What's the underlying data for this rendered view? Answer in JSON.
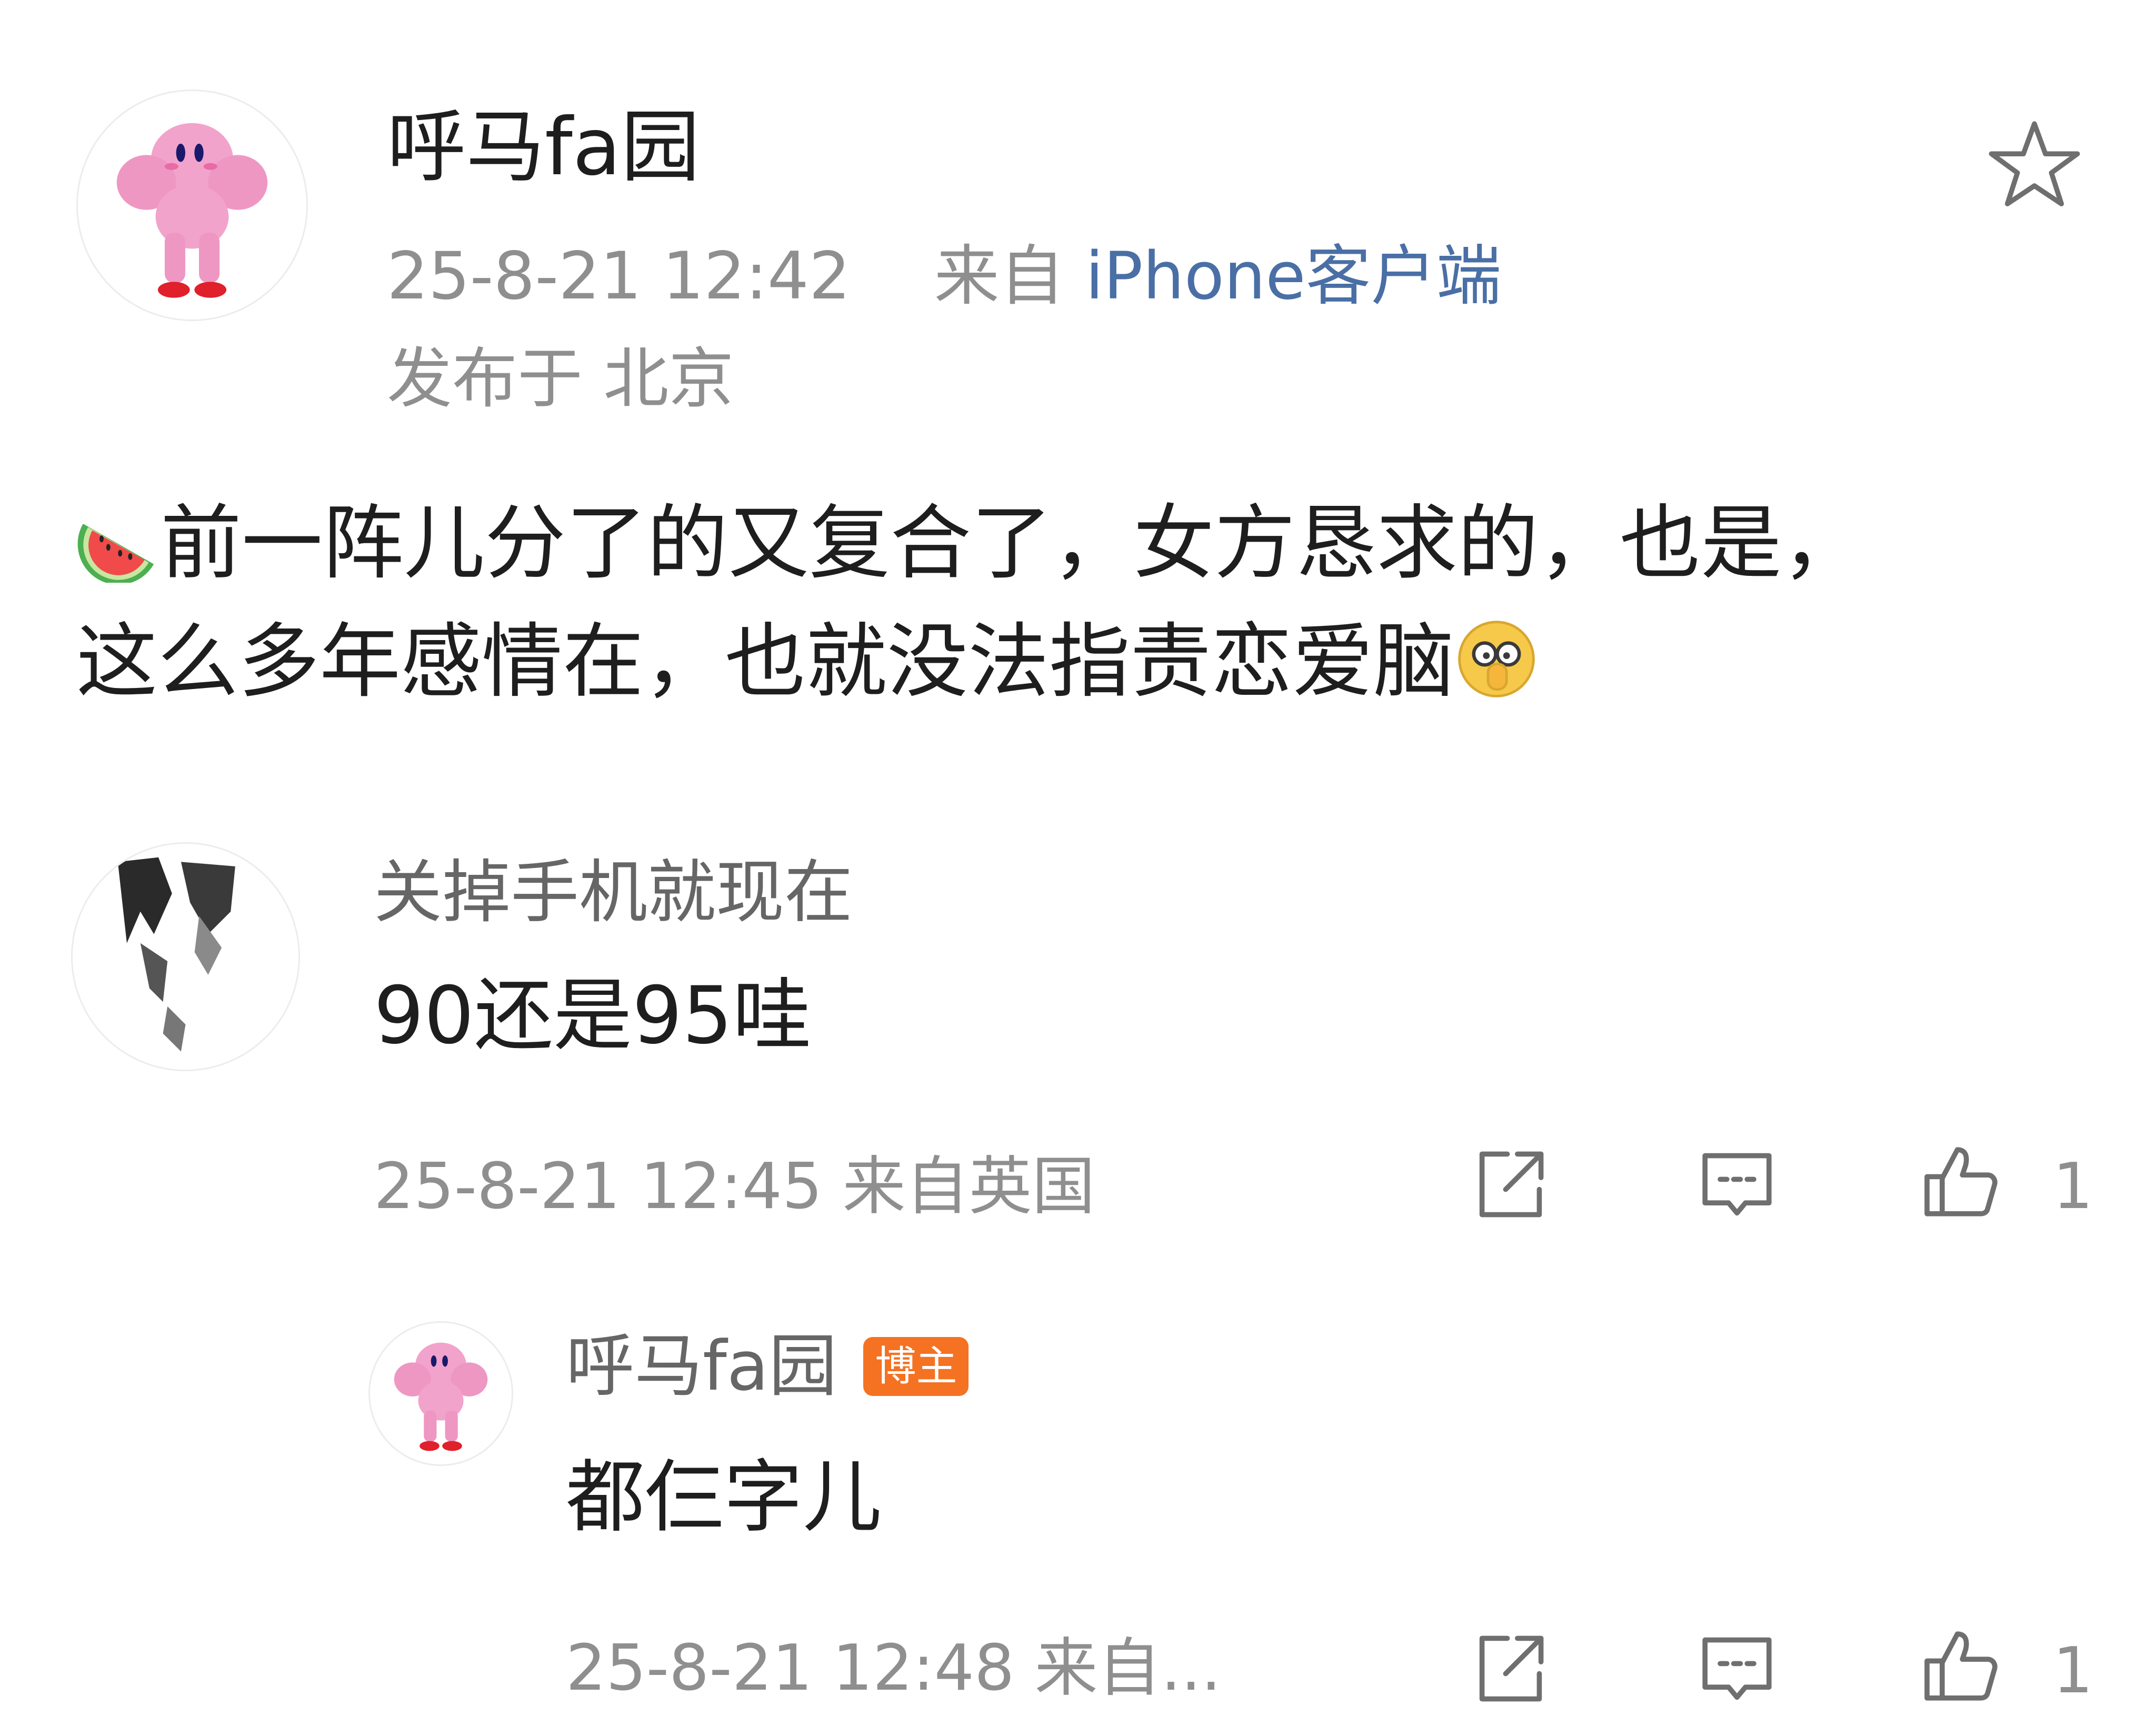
{
  "post": {
    "author": "呼马fa园",
    "date": "25-8-21 12:42",
    "from_prefix": "来自",
    "source": "iPhone客户端",
    "location": "发布于 北京",
    "text_line1": "前一阵儿分了的又复合了，女方恳求的，也是，",
    "text_line2": "这么多年感情在，也就没法指责恋爱脑",
    "favorite_icon": "star-outline-icon",
    "lead_emoji": "watermelon-emoji",
    "tail_emoji": "peek-eyes-emoji"
  },
  "comments": [
    {
      "author": "关掉手机就现在",
      "text": "90还是95哇",
      "meta": "25-8-21 12:45 来自英国",
      "like_count": "1"
    }
  ],
  "reply": {
    "author": "呼马fa园",
    "badge": "博主",
    "text": "都仨字儿",
    "meta": "25-8-21 12:48 来自...",
    "like_count": "1"
  },
  "icons": {
    "share": "share-icon",
    "comment": "comment-icon",
    "like": "thumbs-up-icon"
  },
  "colors": {
    "text": "#1e1e1e",
    "secondary": "#8f8f8f",
    "link": "#4a6fa5",
    "badge": "#f47222",
    "avatar_pink": "#f2a3cc"
  }
}
